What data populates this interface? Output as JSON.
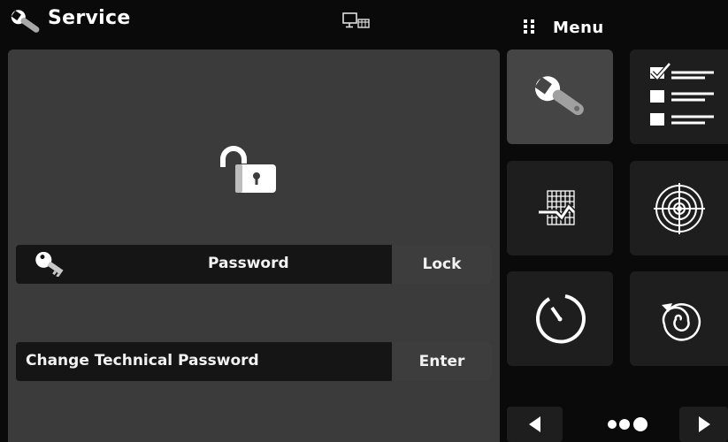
{
  "header": {
    "title": "Service",
    "menu_title": "Menu"
  },
  "main": {
    "password_row": {
      "label": "Password",
      "button": "Lock"
    },
    "change_row": {
      "label": "Change Technical Password",
      "button": "Enter"
    }
  },
  "menu": {
    "tiles": [
      {
        "icon": "wrench-icon",
        "active": true
      },
      {
        "icon": "checklist-icon",
        "active": false
      },
      {
        "icon": "trend-chart-icon",
        "active": false
      },
      {
        "icon": "target-icon",
        "active": false
      },
      {
        "icon": "timer-icon",
        "active": false
      },
      {
        "icon": "spiral-icon",
        "active": false
      }
    ],
    "pages": {
      "total": 3,
      "current": 3
    }
  },
  "colors": {
    "background": "#0a0a0a",
    "panel": "#3b3b3b",
    "row": "#151515",
    "row_button": "#3d3d3d",
    "tile": "#1e1e1e",
    "tile_active": "#454545"
  }
}
